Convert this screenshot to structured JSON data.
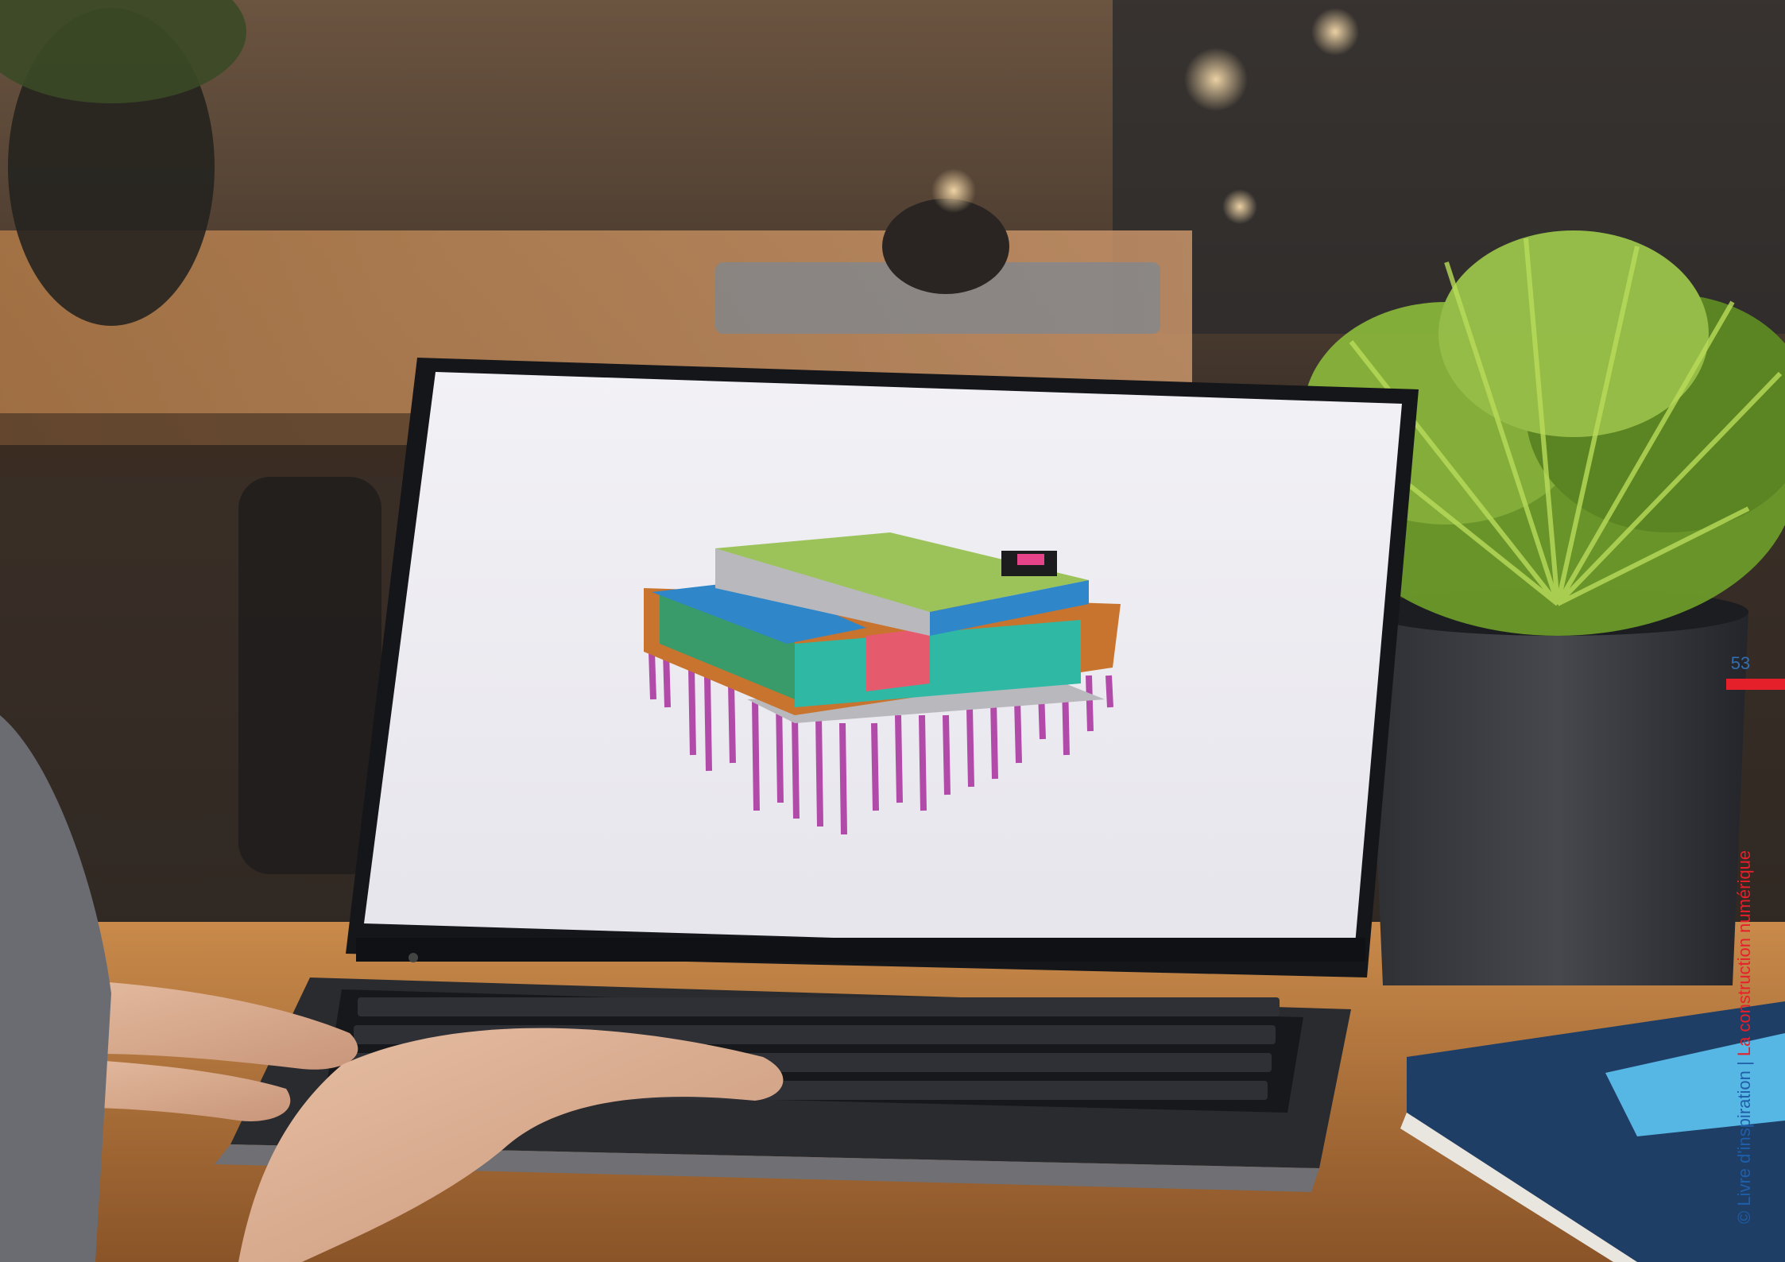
{
  "page": {
    "number": "53",
    "footer": {
      "copyright": "©",
      "book": "Livre d'inspiration",
      "separator": "|",
      "chapter": "La construction numérique"
    }
  },
  "colors": {
    "accent": "#e5202a",
    "text_blue": "#1f5ea8",
    "screen_background": "#ecebf0",
    "model_roof": "#9cc35a",
    "model_slab": "#c8742e",
    "model_water": "#2f86c8",
    "model_piles": "#b14aa8",
    "model_walls": "#2fb9a5",
    "model_core": "#e65a6e"
  },
  "icons": [
    "copyright-icon"
  ]
}
